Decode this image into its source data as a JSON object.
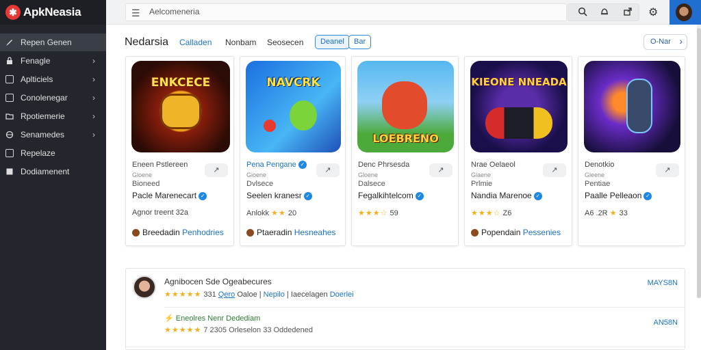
{
  "app": {
    "logo_letter": "✱",
    "title": "ApkNeasia"
  },
  "sidebar": {
    "items": [
      {
        "label": "Repen Genen",
        "icon": "pen-icon",
        "chevron": false
      },
      {
        "label": "Fenagle",
        "icon": "lock-icon",
        "chevron": true
      },
      {
        "label": "Aplticiels",
        "icon": "apps-icon",
        "chevron": true
      },
      {
        "label": "Conolenegar",
        "icon": "grid-icon",
        "chevron": true
      },
      {
        "label": "Rpotiemerie",
        "icon": "folder-icon",
        "chevron": true
      },
      {
        "label": "Senamedes",
        "icon": "globe-icon",
        "chevron": true
      },
      {
        "label": "Repelaze",
        "icon": "box-icon",
        "chevron": false
      },
      {
        "label": "Dodiamenent",
        "icon": "doc-icon",
        "chevron": false
      }
    ]
  },
  "topbar": {
    "search_value": "Aelcomeneria",
    "icons": [
      "search-icon",
      "bell-icon",
      "share-icon",
      "gear-icon",
      "avatar"
    ]
  },
  "section": {
    "title": "Nedarsia",
    "tabs": [
      "Calladen",
      "Nonbam",
      "Seosecen"
    ],
    "pills": [
      "Deanel",
      "Bar"
    ],
    "see_all": "O-Nar"
  },
  "cards": [
    {
      "art_title": "ENKCECE",
      "dev": "Eneen Pstlereen",
      "sub": "Gloene",
      "category": "Bioneed",
      "name": "Pacle Marenecart",
      "rating_prefix": "Agnor treent",
      "stars": "",
      "count": "32a",
      "publisher": "Breedadin",
      "publisher_link": "Penhodries"
    },
    {
      "art_title": "NAVCRK",
      "dev": "Pena Pengane",
      "sub": "Gioene",
      "category": "Dvlsece",
      "name": "Seelen kranesr",
      "rating_prefix": "Anlokk",
      "stars": "★★",
      "count": "20",
      "publisher": "Ptaeradin",
      "publisher_link": "Hesneahes"
    },
    {
      "art_title": "LOEBRENO",
      "dev": "Denc Phrsesda",
      "sub": "Gloene",
      "category": "Dalsece",
      "name": "Fegalkihtelcom",
      "rating_prefix": "",
      "stars": "★★★☆",
      "count": "59",
      "publisher": "",
      "publisher_link": ""
    },
    {
      "art_title": "KIEONE NNEADA",
      "dev": "Nrae Oelaeol",
      "sub": "Glaene",
      "category": "Prlmie",
      "name": "Nandia Marenoe",
      "rating_prefix": "",
      "stars": "★★★☆",
      "count": "Z6",
      "publisher": "Popendain",
      "publisher_link": "Pessenies"
    },
    {
      "art_title": "",
      "dev": "Denotkio",
      "sub": "Gleene",
      "category": "Pentiae",
      "name": "Paalle Pelleaon",
      "rating_prefix": "A6 .2R",
      "stars": "★",
      "count": "33",
      "publisher": "",
      "publisher_link": ""
    }
  ],
  "reviews": [
    {
      "title": "Agnibocen Sde Ogeabecures",
      "stars": "★★★★★",
      "count": "331",
      "link1": "Qero",
      "text": "Oaloe",
      "link2": "Nepilo",
      "text2": "Iaecelagen",
      "link3": "Doerlei",
      "right": "MAYS8N"
    },
    {
      "title": "Eneolres Nenr Dedediam",
      "stars": "★★★★★",
      "meta": "7 2305 Orleselon 33 Oddedened",
      "right": "AN58N"
    }
  ],
  "colors": {
    "sidebar_bg": "#23262d",
    "accent": "#1a73c4",
    "star": "#f2b01e",
    "brand_red": "#e53935"
  }
}
